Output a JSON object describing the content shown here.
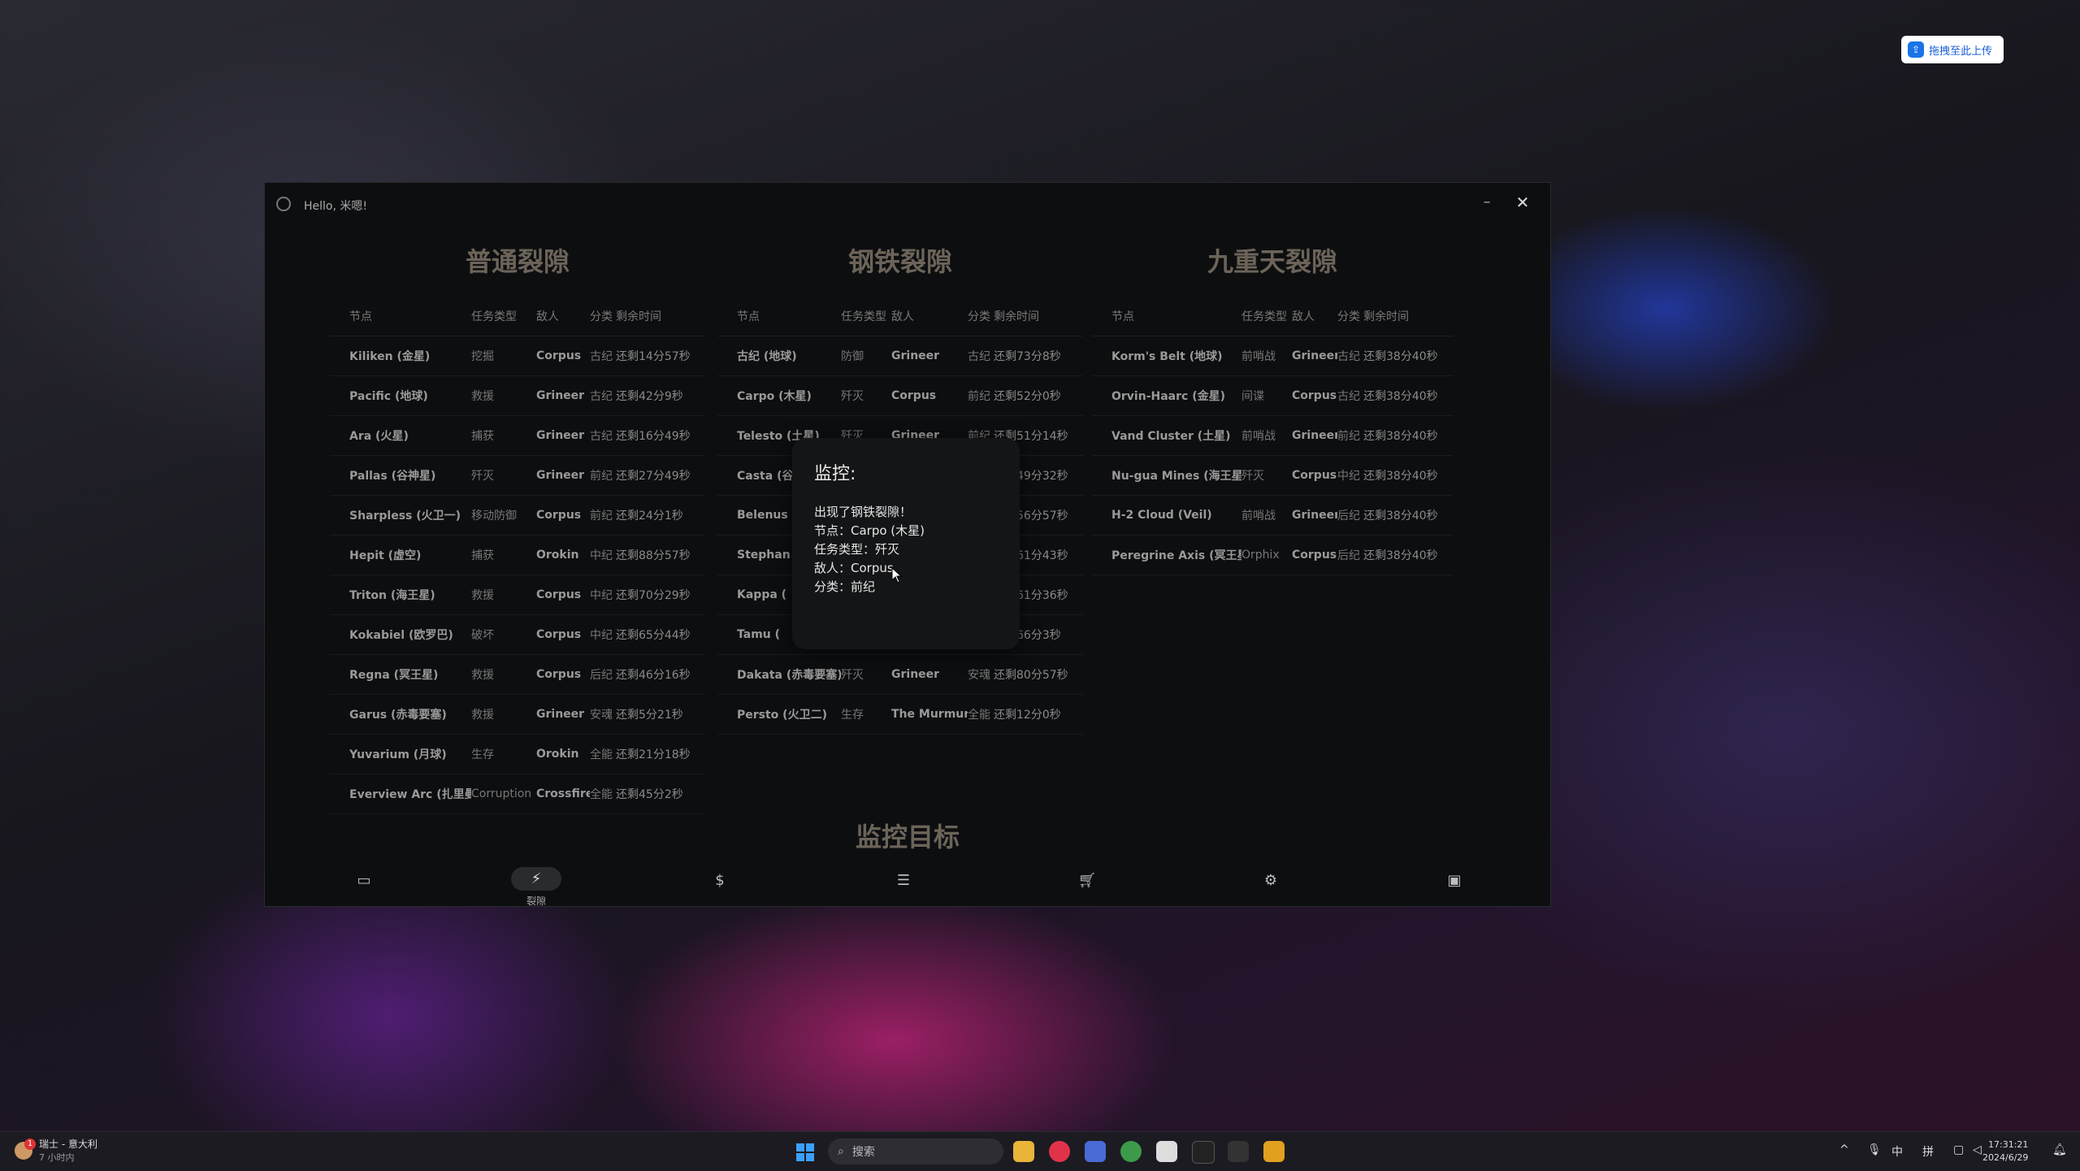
{
  "upload_badge": "拖拽至此上传",
  "app": {
    "greeting": "Hello, 米嗯!",
    "sections": [
      {
        "title": "普通裂隙",
        "headers": [
          "节点",
          "任务类型",
          "敌人",
          "分类",
          "剩余时间"
        ],
        "rows": [
          [
            "Kiliken (金星)",
            "挖掘",
            "Corpus",
            "古纪",
            "还剩14分57秒"
          ],
          [
            "Pacific (地球)",
            "救援",
            "Grineer",
            "古纪",
            "还剩42分9秒"
          ],
          [
            "Ara (火星)",
            "捕获",
            "Grineer",
            "古纪",
            "还剩16分49秒"
          ],
          [
            "Pallas (谷神星)",
            "歼灭",
            "Grineer",
            "前纪",
            "还剩27分49秒"
          ],
          [
            "Sharpless (火卫一)",
            "移动防御",
            "Corpus",
            "前纪",
            "还剩24分1秒"
          ],
          [
            "Hepit (虚空)",
            "捕获",
            "Orokin",
            "中纪",
            "还剩88分57秒"
          ],
          [
            "Triton (海王星)",
            "救援",
            "Corpus",
            "中纪",
            "还剩70分29秒"
          ],
          [
            "Kokabiel (欧罗巴)",
            "破坏",
            "Corpus",
            "中纪",
            "还剩65分44秒"
          ],
          [
            "Regna (冥王星)",
            "救援",
            "Corpus",
            "后纪",
            "还剩46分16秒"
          ],
          [
            "Garus (赤毒要塞)",
            "救援",
            "Grineer",
            "安魂",
            "还剩5分21秒"
          ],
          [
            "Yuvarium (月球)",
            "生存",
            "Orokin",
            "全能",
            "还剩21分18秒"
          ],
          [
            "Everview Arc (扎里曼)",
            "Corruption",
            "Crossfire",
            "全能",
            "还剩45分2秒"
          ]
        ]
      },
      {
        "title": "钢铁裂隙",
        "headers": [
          "节点",
          "任务类型",
          "敌人",
          "分类",
          "剩余时间"
        ],
        "rows": [
          [
            "古纪 (地球)",
            "防御",
            "Grineer",
            "古纪",
            "还剩73分8秒"
          ],
          [
            "Carpo (木星)",
            "歼灭",
            "Corpus",
            "前纪",
            "还剩52分0秒"
          ],
          [
            "Telesto (土星)",
            "歼灭",
            "Grineer",
            "前纪",
            "还剩51分14秒"
          ],
          [
            "Casta (谷",
            "",
            "",
            "",
            "还剩49分32秒"
          ],
          [
            "Belenus",
            "",
            "",
            "",
            "还剩56分57秒"
          ],
          [
            "Stephan",
            "",
            "",
            "",
            "还剩61分43秒"
          ],
          [
            "Kappa (",
            "",
            "",
            "",
            "还剩61分36秒"
          ],
          [
            "Tamu (",
            "",
            "",
            "",
            "还剩66分3秒"
          ],
          [
            "Dakata (赤毒要塞)",
            "歼灭",
            "Grineer",
            "安魂",
            "还剩80分57秒"
          ],
          [
            "Persto (火卫二)",
            "生存",
            "The Murmur",
            "全能",
            "还剩12分0秒"
          ]
        ]
      },
      {
        "title": "九重天裂隙",
        "headers": [
          "节点",
          "任务类型",
          "敌人",
          "分类",
          "剩余时间"
        ],
        "rows": [
          [
            "Korm's Belt (地球)",
            "前哨战",
            "Grineer",
            "古纪",
            "还剩38分40秒"
          ],
          [
            "Orvin-Haarc (金星)",
            "间谍",
            "Corpus",
            "古纪",
            "还剩38分40秒"
          ],
          [
            "Vand Cluster (土星)",
            "前哨战",
            "Grineer",
            "前纪",
            "还剩38分40秒"
          ],
          [
            "Nu-gua Mines (海王星)",
            "歼灭",
            "Corpus",
            "中纪",
            "还剩38分40秒"
          ],
          [
            "H-2 Cloud (Veil)",
            "前哨战",
            "Grineer",
            "后纪",
            "还剩38分40秒"
          ],
          [
            "Peregrine Axis (冥王星)",
            "Orphix",
            "Corpus",
            "后纪",
            "还剩38分40秒"
          ]
        ]
      }
    ],
    "watch_title": "监控目标",
    "nav": {
      "active_label": "裂隙",
      "icons": [
        "tablet-icon",
        "lightning-icon",
        "dollar-icon",
        "list-icon",
        "cart-icon",
        "gear-icon",
        "gamepad-icon"
      ]
    },
    "popup": {
      "heading": "监控:",
      "line1": "出现了钢铁裂隙！",
      "line2": "节点：Carpo (木星)",
      "line3": "任务类型：歼灭",
      "line4": "敌人：Corpus",
      "line5": "分类：前纪"
    }
  },
  "taskbar": {
    "weather_title": "瑞士 - 意大利",
    "weather_sub": "7 小时内",
    "weather_badge": "1",
    "search_placeholder": "搜索",
    "ime1": "中",
    "ime2": "拼",
    "time": "17:31:21",
    "date": "2024/6/29"
  }
}
